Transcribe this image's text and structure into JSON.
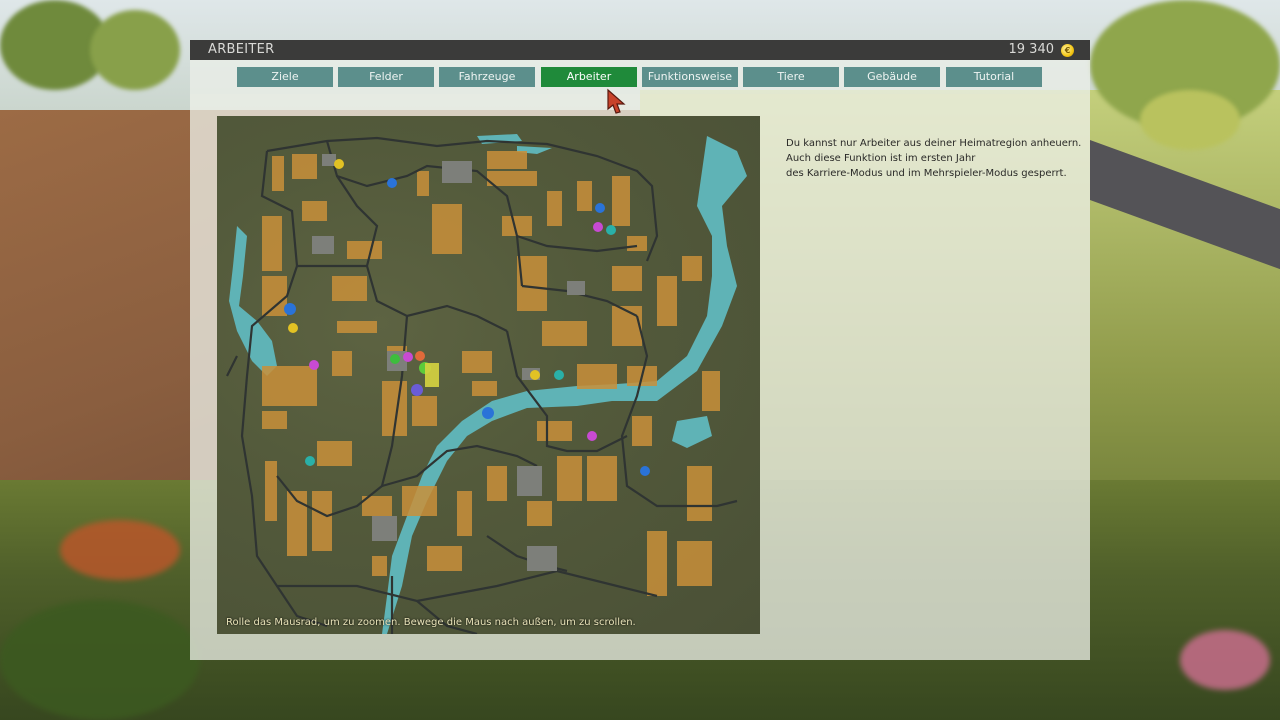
{
  "window": {
    "title": "ARBEITER",
    "money": "19 340",
    "currency_symbol": "€"
  },
  "tabs": [
    {
      "label": "Ziele",
      "active": false
    },
    {
      "label": "Felder",
      "active": false
    },
    {
      "label": "Fahrzeuge",
      "active": false
    },
    {
      "label": "Arbeiter",
      "active": true
    },
    {
      "label": "Funktionsweise",
      "active": false
    },
    {
      "label": "Tiere",
      "active": false
    },
    {
      "label": "Gebäude",
      "active": false
    },
    {
      "label": "Tutorial",
      "active": false
    }
  ],
  "map": {
    "hint": "Rolle das Mausrad, um zu zoomen. Bewege die Maus nach außen, um zu scrollen.",
    "water_color": "#5fb3b6",
    "field_color": "#c9903a",
    "road_color": "#2f3432",
    "markers": [
      {
        "type": "shop",
        "icon": "shop-icon",
        "color": "#e2c224"
      },
      {
        "type": "animal",
        "icon": "cow-icon",
        "color": "#2a73d8"
      },
      {
        "type": "sell",
        "icon": "sell-point-icon",
        "color": "#c84ad3"
      },
      {
        "type": "silo",
        "icon": "silo-icon",
        "color": "#2ab0a8"
      },
      {
        "type": "player",
        "icon": "player-icon",
        "color": "#6a5cd6"
      }
    ]
  },
  "info": {
    "line1": "Du kannst nur Arbeiter aus deiner Heimatregion anheuern.",
    "line2": "Auch diese Funktion ist im ersten Jahr",
    "line3": "des Karriere-Modus und im Mehrspieler-Modus gesperrt."
  },
  "colors": {
    "tab_bg": "#5c8f8c",
    "tab_active_bg": "#1f8a3a",
    "titlebar_bg": "#3b3b3a"
  }
}
